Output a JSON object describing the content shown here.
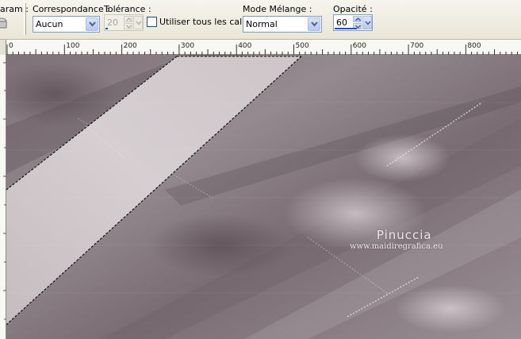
{
  "toolbar": {
    "param_label": "aram.:",
    "correspondance": {
      "label": "Correspondance :",
      "value": "Aucun"
    },
    "tolerance": {
      "label": "Tolérance :",
      "value": "20",
      "disabled": true
    },
    "all_layers": {
      "label": "Utiliser tous les calques",
      "checked": false
    },
    "blend_mode": {
      "label": "Mode Mélange :",
      "value": "Normal"
    },
    "opacity": {
      "label": "Opacité :",
      "value": "60"
    }
  },
  "ruler": {
    "ticks": [
      "0",
      "100",
      "200",
      "300",
      "400",
      "500",
      "600",
      "700",
      "800"
    ]
  },
  "canvas": {
    "watermark_name": "Pinuccia",
    "watermark_url": "www.maidiregrafica.eu"
  },
  "colors": {
    "toolbar_bg": "#ece9d8",
    "combo_border": "#7f9db9",
    "canvas_base": "#8a7d82",
    "selection_stripe": "#cfc8ca",
    "accent": "#1e4fd0"
  },
  "icons": [
    "bucket-icon",
    "chevron-down-icon",
    "spin-up-icon",
    "spin-down-icon"
  ]
}
